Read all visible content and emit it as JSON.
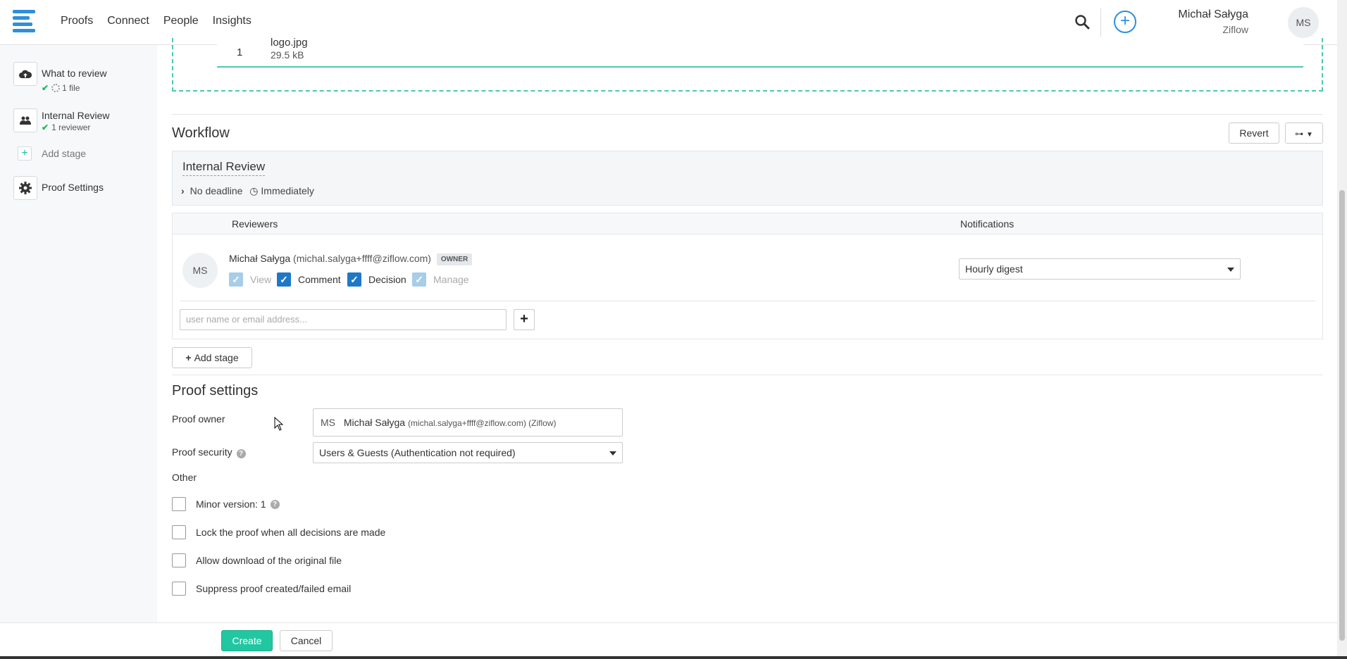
{
  "nav": {
    "items": [
      "Proofs",
      "Connect",
      "People",
      "Insights"
    ]
  },
  "user": {
    "name": "Michał Sałyga",
    "org": "Ziflow",
    "initials": "MS"
  },
  "sidebar": {
    "what_to_review": "What to review",
    "files": "1 file",
    "internal_review": "Internal Review",
    "reviewers": "1 reviewer",
    "add_stage": "Add stage",
    "proof_settings": "Proof Settings"
  },
  "file": {
    "index": "1",
    "name": "logo.jpg",
    "size": "29.5 kB"
  },
  "workflow": {
    "title": "Workflow",
    "revert": "Revert",
    "stage_name": "Internal Review",
    "deadline": "No deadline",
    "start": "Immediately",
    "col_reviewers": "Reviewers",
    "col_notifications": "Notifications",
    "reviewer": {
      "initials": "MS",
      "name": "Michał Sałyga",
      "email": "(michal.salyga+ffff@ziflow.com)",
      "badge": "OWNER",
      "perm_view": "View",
      "perm_comment": "Comment",
      "perm_decision": "Decision",
      "perm_manage": "Manage",
      "notification": "Hourly digest"
    },
    "input_placeholder": "user name or email address...",
    "add_stage": "Add stage"
  },
  "proof_settings": {
    "title": "Proof settings",
    "owner_label": "Proof owner",
    "owner_initials": "MS",
    "owner_name": "Michał Sałyga",
    "owner_detail": "(michal.salyga+ffff@ziflow.com) (Ziflow)",
    "security_label": "Proof security",
    "security_value": "Users & Guests (Authentication not required)",
    "other_label": "Other",
    "options": [
      "Minor version: 1",
      "Lock the proof when all decisions are made",
      "Allow download of the original file",
      "Suppress proof created/failed email"
    ]
  },
  "footer": {
    "create": "Create",
    "cancel": "Cancel"
  },
  "colors": {
    "accent": "#2e8fdc",
    "primary_button": "#21c7a1",
    "checkbox": "#1f78c7"
  }
}
